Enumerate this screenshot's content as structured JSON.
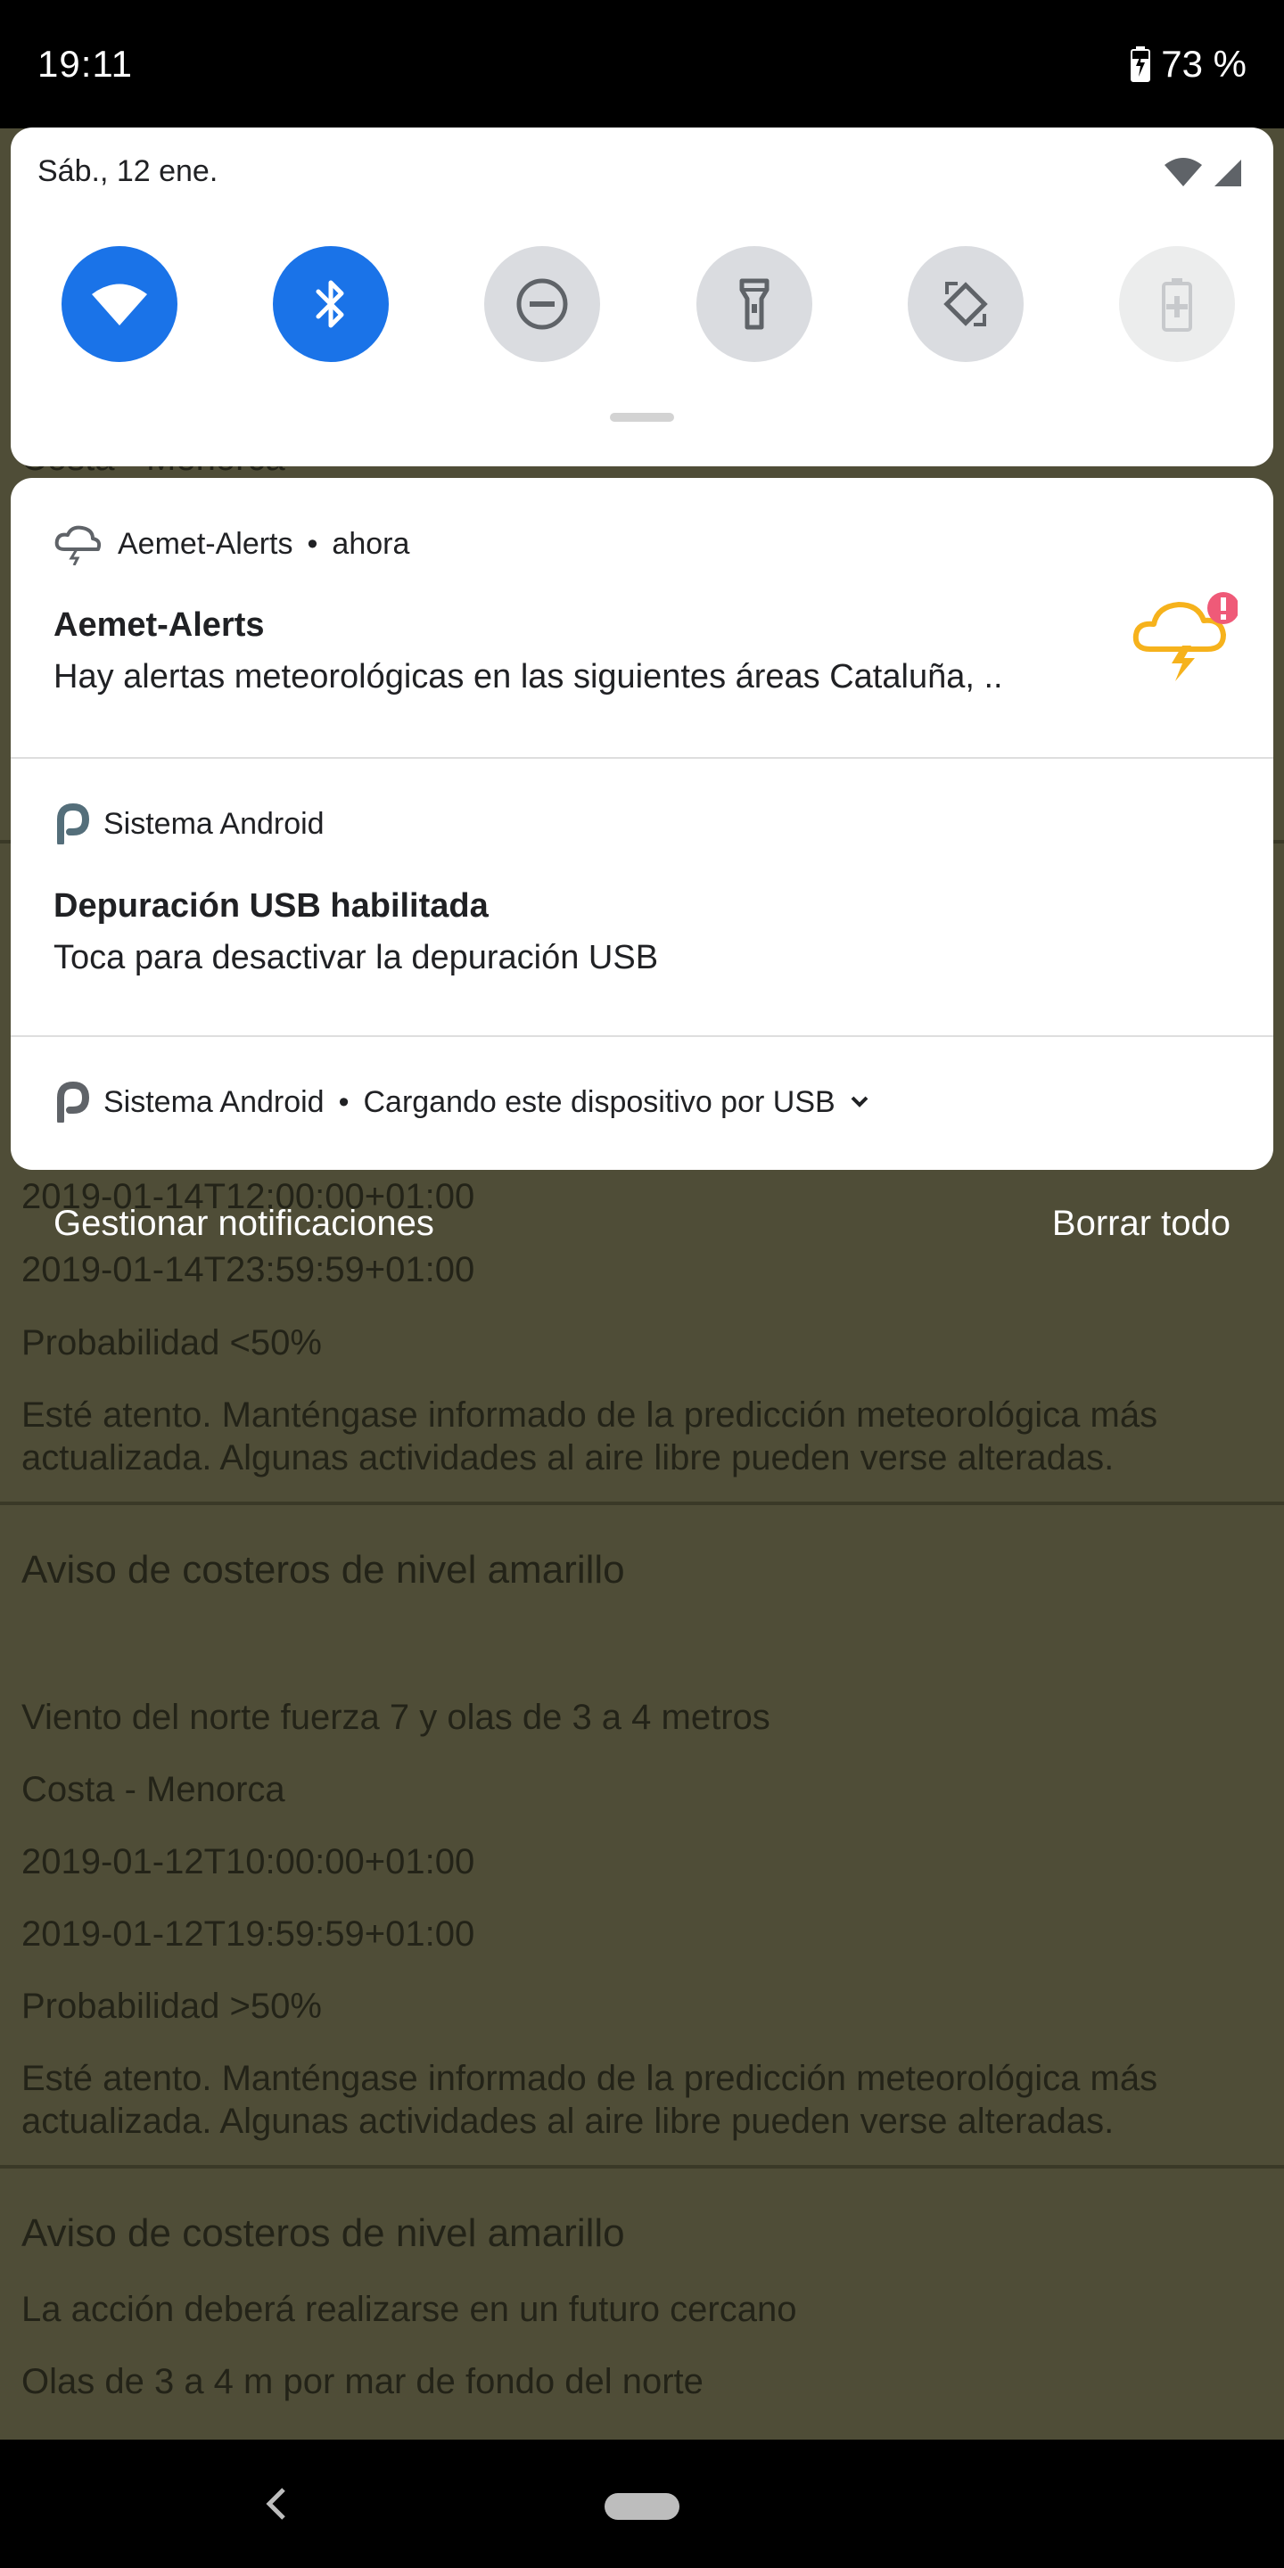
{
  "status_bar": {
    "time": "19:11",
    "battery": "73 %"
  },
  "quick_settings": {
    "date": "Sáb., 12 ene.",
    "tiles": [
      {
        "icon": "wifi-icon",
        "state": "on"
      },
      {
        "icon": "bluetooth-icon",
        "state": "on"
      },
      {
        "icon": "do-not-disturb-icon",
        "state": "off"
      },
      {
        "icon": "flashlight-icon",
        "state": "off"
      },
      {
        "icon": "auto-rotate-icon",
        "state": "off"
      },
      {
        "icon": "battery-saver-icon",
        "state": "disabled"
      }
    ],
    "colors": {
      "active": "#1a73e8",
      "inactive": "#dadce0"
    }
  },
  "notifications": [
    {
      "app": "Aemet-Alerts",
      "time": "ahora",
      "title": "Aemet-Alerts",
      "text": "Hay alertas meteorológicas en las siguientes áreas Cataluña, ..",
      "icon": "storm-cloud-icon"
    },
    {
      "app": "Sistema Android",
      "title": "Depuración USB habilitada",
      "text": "Toca para desactivar la depuración USB",
      "icon": "android-p-icon"
    },
    {
      "app": "Sistema Android",
      "summary": "Cargando este dispositivo por USB",
      "icon": "android-p-icon"
    }
  ],
  "footer": {
    "manage": "Gestionar notificaciones",
    "clear_all": "Borrar todo"
  },
  "background_app": {
    "partial_top": "Costa - Menorca",
    "lines_a": [
      "2019-01-14T12:00:00+01:00",
      "2019-01-14T23:59:59+01:00",
      "Probabilidad <50%"
    ],
    "para_a": "Esté atento. Manténgase informado de la predicción meteorológica más actualizada. Algunas actividades al aire libre pueden verse alteradas.",
    "heading_b": "Aviso de costeros de nivel amarillo",
    "lines_b": [
      "Viento del norte fuerza 7 y olas de 3 a 4 metros",
      "Costa - Menorca",
      "2019-01-12T10:00:00+01:00",
      "2019-01-12T19:59:59+01:00",
      "Probabilidad >50%"
    ],
    "para_b": "Esté atento. Manténgase informado de la predicción meteorológica más actualizada. Algunas actividades al aire libre pueden verse alteradas.",
    "heading_c": "Aviso de costeros de nivel amarillo",
    "lines_c": [
      "La acción deberá realizarse en un futuro cercano",
      "Olas de 3 a 4 m por mar de fondo del norte"
    ]
  }
}
